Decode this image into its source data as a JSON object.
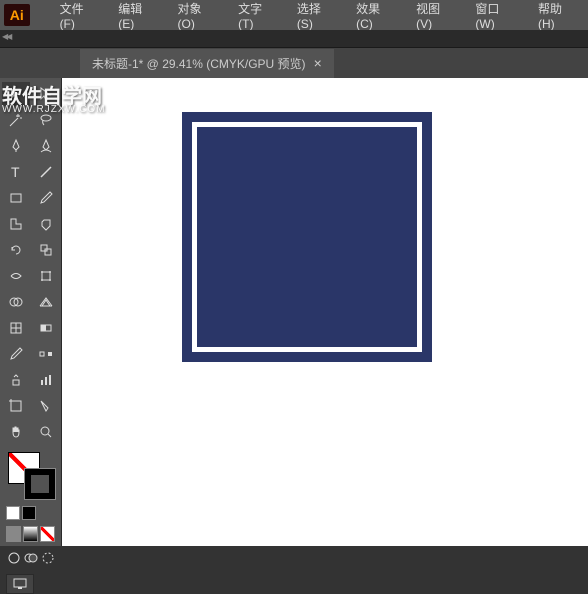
{
  "app": {
    "icon_text": "Ai"
  },
  "menu": {
    "items": [
      {
        "label": "文件(F)"
      },
      {
        "label": "编辑(E)"
      },
      {
        "label": "对象(O)"
      },
      {
        "label": "文字(T)"
      },
      {
        "label": "选择(S)"
      },
      {
        "label": "效果(C)"
      },
      {
        "label": "视图(V)"
      },
      {
        "label": "窗口(W)"
      },
      {
        "label": "帮助(H)"
      }
    ]
  },
  "tab": {
    "title": "未标题-1* @ 29.41%  (CMYK/GPU 预览)",
    "close": "×"
  },
  "watermark": {
    "main": "软件自学网",
    "sub": "WWW.RJZXW.COM"
  },
  "artwork": {
    "fill": "#2a3668",
    "stroke": "#ffffff"
  }
}
